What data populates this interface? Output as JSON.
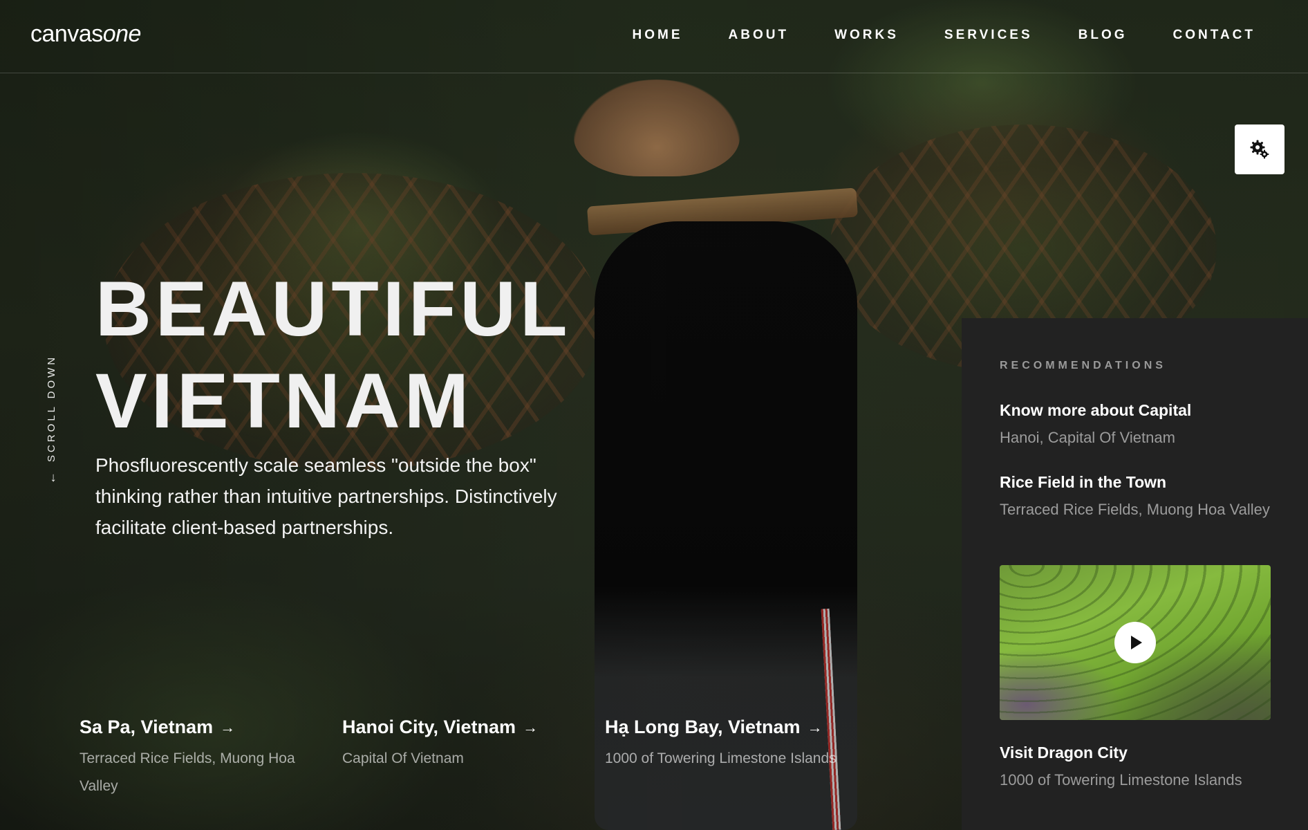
{
  "header": {
    "logo_part1": "canvas",
    "logo_part2": "one",
    "nav": [
      "HOME",
      "ABOUT",
      "WORKS",
      "SERVICES",
      "BLOG",
      "CONTACT"
    ],
    "settings_icon": "gear-icon"
  },
  "hero": {
    "scroll_down": "SCROLL DOWN",
    "scroll_icon": "arrow-down-icon",
    "headline_line1": "BEAUTIFUL",
    "headline_line2": "VIETNAM",
    "subtext": "Phosfluorescently scale seamless \"outside the box\" thinking rather than intuitive partnerships. Distinctively facilitate client-based partnerships."
  },
  "destinations": [
    {
      "title": "Sa Pa, Vietnam",
      "subtitle": "Terraced Rice Fields, Muong Hoa Valley"
    },
    {
      "title": "Hanoi City, Vietnam",
      "subtitle": "Capital Of Vietnam"
    },
    {
      "title": "Hạ Long Bay, Vietnam",
      "subtitle": "1000 of Towering Limestone Islands"
    }
  ],
  "recommendations": {
    "heading": "RECOMMENDATIONS",
    "items": [
      {
        "title": "Know more about Capital",
        "subtitle": "Hanoi, Capital Of Vietnam"
      },
      {
        "title": "Rice Field in the Town",
        "subtitle": "Terraced Rice Fields, Muong Hoa Valley"
      }
    ],
    "video": {
      "play_icon": "play-icon",
      "title": "Visit Dragon City",
      "subtitle": "1000 of Towering Limestone Islands"
    }
  },
  "colors": {
    "panel_bg": "#222222",
    "panel_muted_text": "#9c9c9c",
    "headline": "#f0f0f0"
  }
}
